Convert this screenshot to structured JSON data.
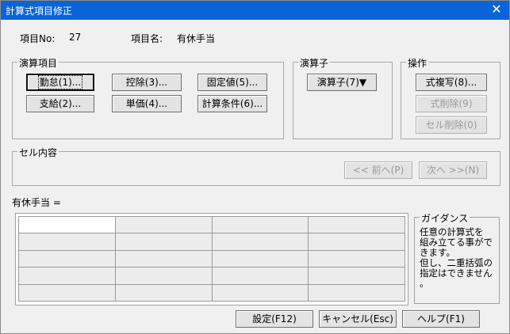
{
  "window": {
    "title": "計算式項目修正",
    "close_glyph": "✕"
  },
  "header": {
    "item_no_label": "項目No:",
    "item_no_value": "27",
    "item_name_label": "項目名:",
    "item_name_value": "有休手当"
  },
  "operation_items": {
    "legend": "演算項目",
    "buttons": {
      "kintai": "勤怠(1)...",
      "kojo": "控除(3)...",
      "koteichi": "固定値(5)...",
      "shikyu": "支給(2)...",
      "tanka": "単価(4)...",
      "keisan_joken": "計算条件(6)..."
    }
  },
  "operator": {
    "legend": "演算子",
    "button": "演算子(7)▼"
  },
  "actions": {
    "legend": "操作",
    "copy_formula": "式複写(8)...",
    "delete_formula": "式削除(9)",
    "delete_cell": "セル削除(0)"
  },
  "cell_content": {
    "legend": "セル内容",
    "prev": "<< 前へ(P)",
    "next": "次へ >>(N)"
  },
  "formula": {
    "label": "有休手当 =",
    "rows": 5,
    "cols": 4
  },
  "guidance": {
    "legend": "ガイダンス",
    "lines": [
      "任意の計算式を",
      "組み立てる事がで",
      "きます。",
      "但し、二重括弧の",
      "指定はできません",
      "。"
    ]
  },
  "footer": {
    "ok": "設定(F12)",
    "cancel": "キャンセル(Esc)",
    "help": "ヘルプ(F1)"
  },
  "colors": {
    "titlebar": "#0a64d8",
    "dialog_bg": "#f0f0f0",
    "disabled_text": "#9a9a9a"
  }
}
